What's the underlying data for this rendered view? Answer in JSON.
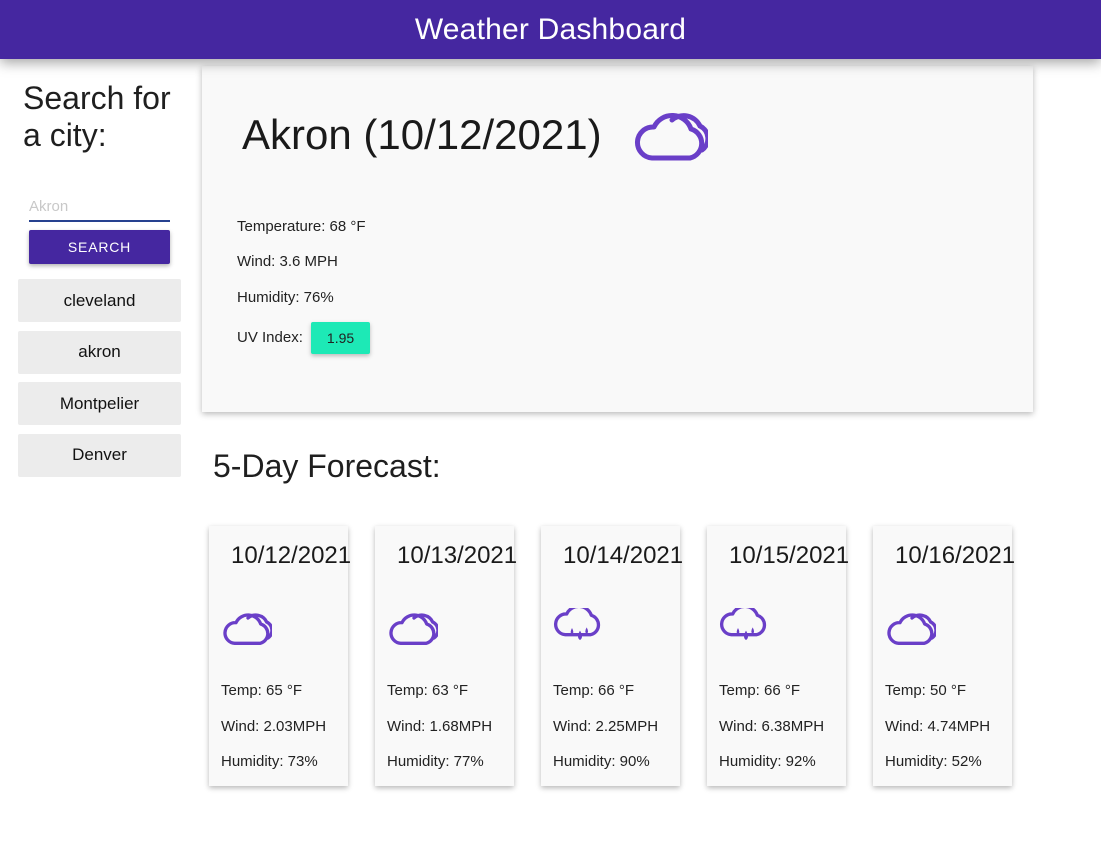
{
  "header": {
    "title": "Weather Dashboard"
  },
  "sidebar": {
    "heading": "Search for a city:",
    "search_placeholder": "Akron",
    "search_button": "SEARCH",
    "history": [
      "cleveland",
      "akron",
      "Montpelier",
      "Denver"
    ]
  },
  "current": {
    "title": "Akron (10/12/2021)",
    "icon": "cloud-icon",
    "temperature": "Temperature: 68 °F",
    "wind": "Wind: 3.6 MPH",
    "humidity": "Humidity: 76%",
    "uv_label": "UV Index:",
    "uv_value": "1.95",
    "uv_color": "#1de9b6"
  },
  "forecast": {
    "title": "5-Day Forecast:",
    "days": [
      {
        "date": "10/12/2021",
        "icon": "cloud-icon",
        "temp": "Temp: 65 °F",
        "wind": "Wind: 2.03MPH",
        "humidity": "Humidity: 73%"
      },
      {
        "date": "10/13/2021",
        "icon": "cloud-icon",
        "temp": "Temp: 63 °F",
        "wind": "Wind: 1.68MPH",
        "humidity": "Humidity: 77%"
      },
      {
        "date": "10/14/2021",
        "icon": "cloud-rain-icon",
        "temp": "Temp: 66 °F",
        "wind": "Wind: 2.25MPH",
        "humidity": "Humidity: 90%"
      },
      {
        "date": "10/15/2021",
        "icon": "cloud-rain-icon",
        "temp": "Temp: 66 °F",
        "wind": "Wind: 6.38MPH",
        "humidity": "Humidity: 92%"
      },
      {
        "date": "10/16/2021",
        "icon": "cloud-icon",
        "temp": "Temp: 50 °F",
        "wind": "Wind: 4.74MPH",
        "humidity": "Humidity: 52%"
      }
    ]
  },
  "colors": {
    "primary": "#4527a0",
    "icon": "#6a3fc8",
    "card": "#f9f9f9",
    "history_bg": "#ececec"
  }
}
